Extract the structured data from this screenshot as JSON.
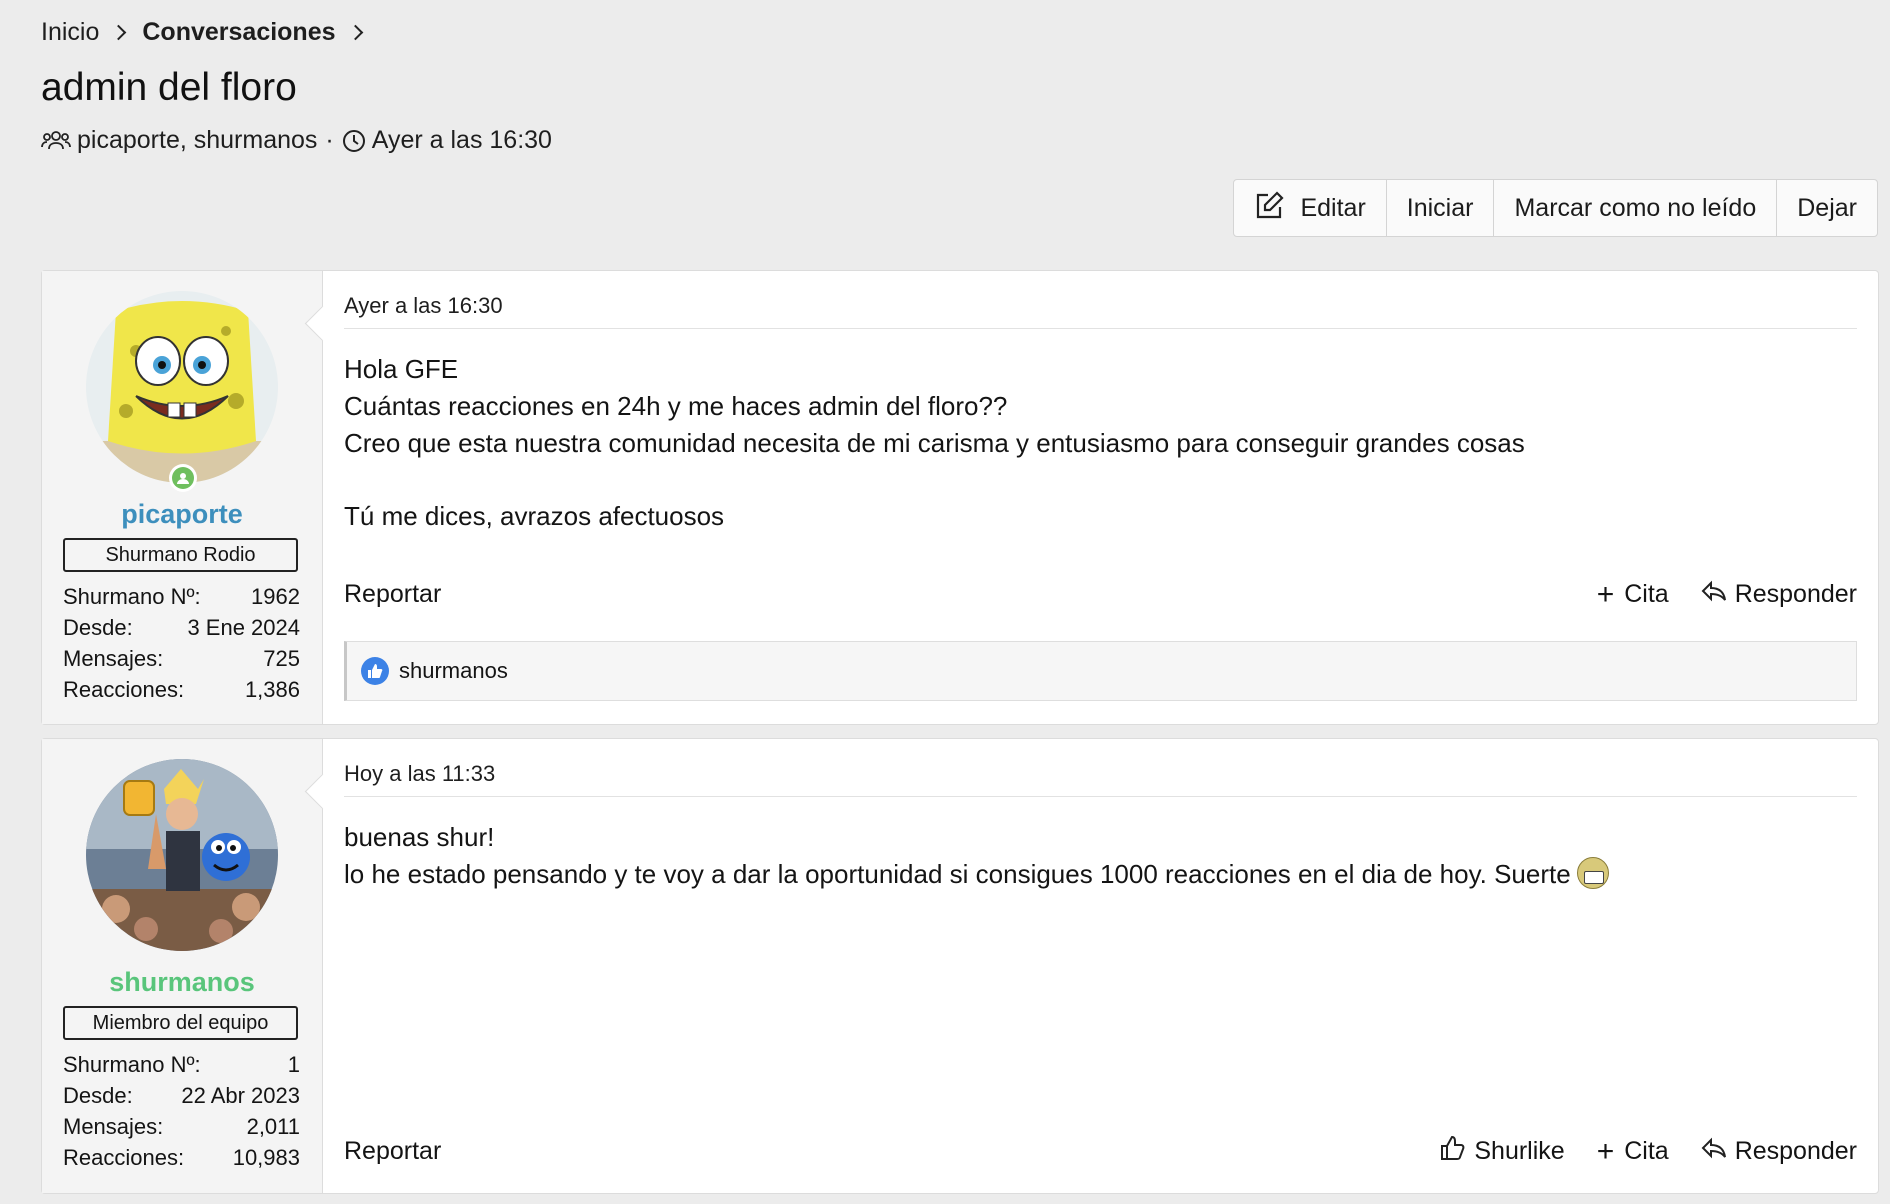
{
  "breadcrumb": {
    "home": "Inicio",
    "current": "Conversaciones"
  },
  "thread": {
    "title": "admin del floro",
    "participants": "picaporte, shurmanos",
    "separator": "·",
    "time": "Ayer a las 16:30"
  },
  "toolbar": {
    "edit": "Editar",
    "start": "Iniciar",
    "mark_unread": "Marcar como no leído",
    "leave": "Dejar"
  },
  "labels": {
    "shurmano_no": "Shurmano Nº:",
    "since": "Desde:",
    "messages": "Mensajes:",
    "reactions": "Reacciones:",
    "report": "Reportar",
    "quote": "Cita",
    "reply": "Responder",
    "like": "Shurlike"
  },
  "messages": [
    {
      "username": "picaporte",
      "user_title": "Shurmano Rodio",
      "shurmano_no": "1962",
      "since": "3 Ene 2024",
      "messages": "725",
      "reactions": "1,386",
      "date": "Ayer a las 16:30",
      "lines": [
        "Hola GFE",
        "Cuántas reacciones en 24h y me haces admin del floro??",
        "Creo que esta nuestra comunidad necesita de mi carisma y entusiasmo para conseguir grandes cosas",
        "Tú me dices, avrazos afectuosos"
      ],
      "reacted_by": "shurmanos",
      "username_color": "#3d8fbd"
    },
    {
      "username": "shurmanos",
      "user_title": "Miembro del equipo",
      "shurmano_no": "1",
      "since": "22 Abr 2023",
      "messages": "2,011",
      "reactions": "10,983",
      "date": "Hoy a las 11:33",
      "lines": [
        "buenas shur!",
        "lo he estado pensando y te voy a dar la oportunidad si consigues 1000 reacciones en el dia de hoy. Suerte"
      ],
      "username_color": "#59c57b"
    }
  ]
}
